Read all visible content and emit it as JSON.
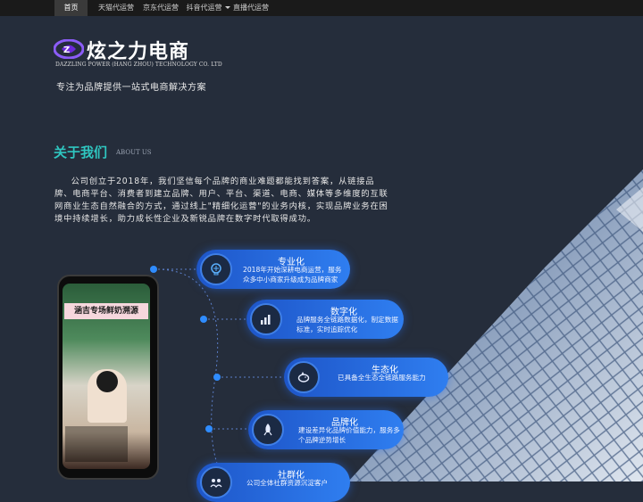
{
  "nav": {
    "items": [
      {
        "label": "首页",
        "active": true
      },
      {
        "label": "天猫代运营"
      },
      {
        "label": "京东代运营"
      },
      {
        "label": "抖音代运营"
      },
      {
        "label": "直播代运营"
      }
    ]
  },
  "brand": {
    "title": "炫之力电商",
    "subtitle": "DAZZLING POWER (HANG ZHOU) TECHNOLOGY CO. LTD",
    "tagline": "专注为品牌提供一站式电商解决方案"
  },
  "about": {
    "title": "关于我们",
    "title_en": "ABOUT US",
    "text": "公司创立于2018年，我们坚信每个品牌的商业难题都能找到答案，从链接品牌、电商平台、消费者到建立品牌、用户、平台、渠道、电商、媒体等多维度的互联网商业生态自然融合的方式，通过线上\"精细化运营\"的业务内核，实现品牌业务在困境中持续增长，助力成长性企业及新锐品牌在数字时代取得成功。"
  },
  "phone": {
    "banner": "涵吉专场鲜奶溯源"
  },
  "features": [
    {
      "title": "专业化",
      "desc": "2018年开始深耕电商运营，服务众多中小商家升级成为品牌商家",
      "icon": "brain-icon"
    },
    {
      "title": "数字化",
      "desc": "品牌服务全链路数据化，制定数据标准，实时追踪优化",
      "icon": "chart-icon"
    },
    {
      "title": "生态化",
      "desc": "已具备全生态全链路服务能力",
      "icon": "piggy-bank-icon"
    },
    {
      "title": "品牌化",
      "desc": "建设差异化品牌价值能力，服务多个品牌逆势增长",
      "icon": "rocket-icon"
    },
    {
      "title": "社群化",
      "desc": "公司全体社群资源沉淀客户",
      "icon": "community-icon"
    }
  ],
  "colors": {
    "accent": "#2fc6c0",
    "card": "#2f7ef0",
    "background": "#252d3b"
  }
}
